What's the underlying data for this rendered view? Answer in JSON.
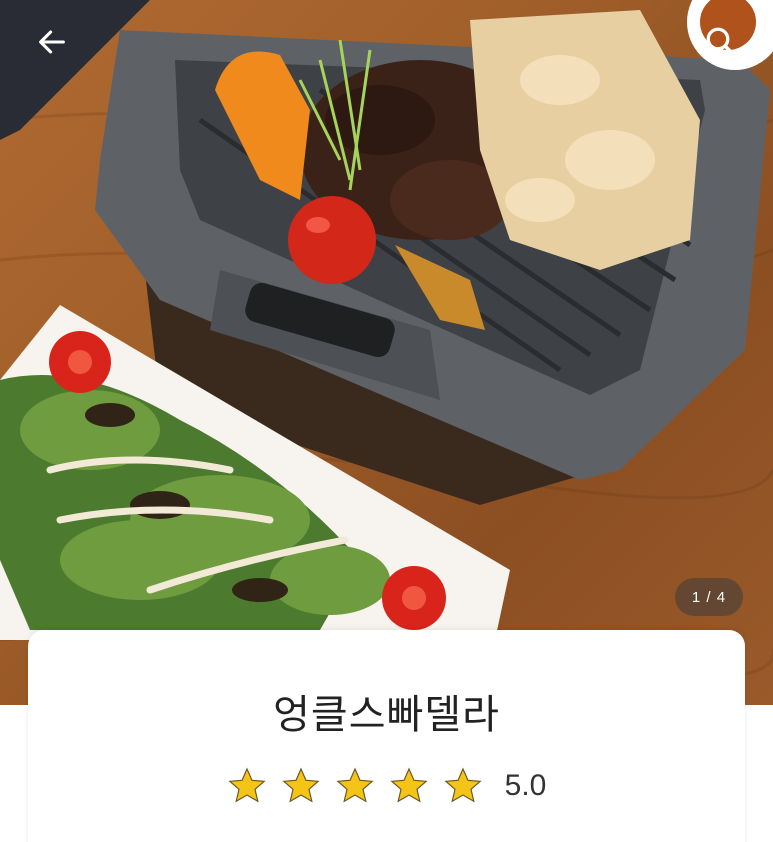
{
  "header": {
    "back_icon": "arrow-left-icon",
    "search_icon": "search-icon"
  },
  "gallery": {
    "counter": "1 / 4",
    "current_photo": 1,
    "total_photos": 4
  },
  "restaurant": {
    "name": "엉클스빠델라",
    "rating": 5.0,
    "rating_text": "5.0",
    "stars": 5,
    "star_color": "#f5c419"
  }
}
